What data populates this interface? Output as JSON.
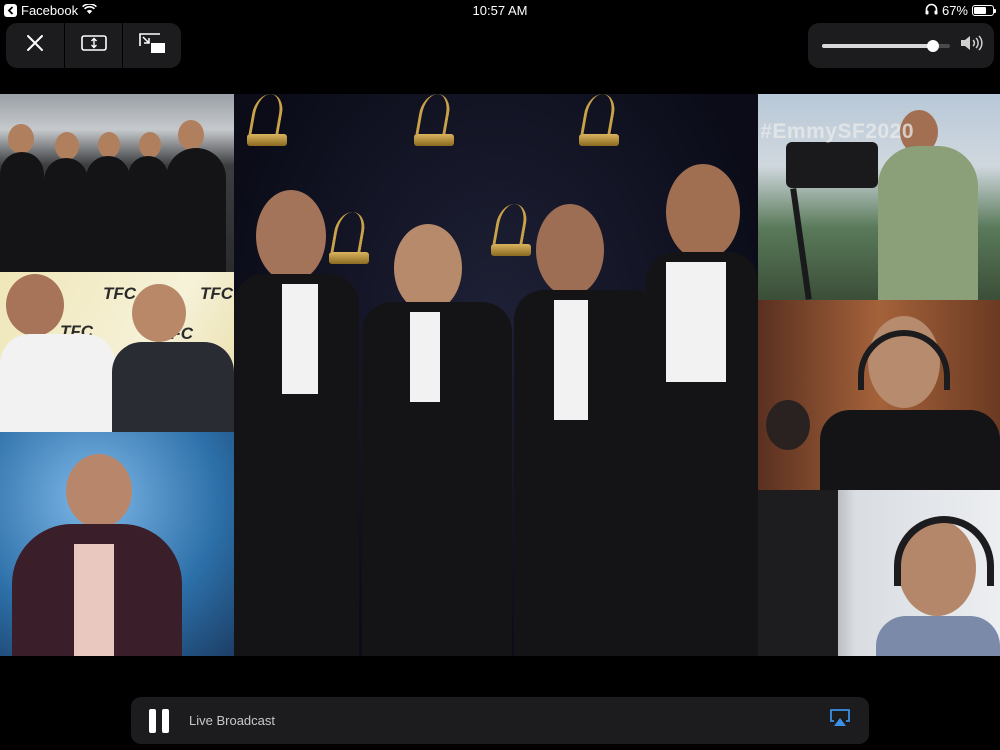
{
  "status_bar": {
    "back_app": "Facebook",
    "time": "10:57 AM",
    "battery": "67%",
    "battery_level": 0.67
  },
  "player_controls": {
    "close_icon": "close-icon",
    "resize_icon": "resize-icon",
    "pip_icon": "picture-in-picture-icon",
    "volume_level": 0.87,
    "volume_icon": "speaker-icon"
  },
  "video": {
    "watermark": "#EmmySF2020",
    "tfc_logo": "TFC"
  },
  "bottom_bar": {
    "pause_icon": "pause-icon",
    "label": "Live Broadcast",
    "airplay_icon": "airplay-icon"
  }
}
